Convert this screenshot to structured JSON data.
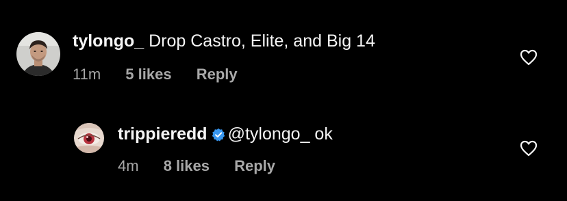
{
  "comments": [
    {
      "username": "tylongo_",
      "text": "Drop Castro, Elite, and Big 14",
      "time": "11m",
      "likes": "5 likes",
      "reply": "Reply",
      "verified": false
    },
    {
      "username": "trippieredd",
      "text": "@tylongo_ ok",
      "time": "4m",
      "likes": "8 likes",
      "reply": "Reply",
      "verified": true
    }
  ],
  "icons": {
    "like": "heart-outline-icon",
    "verified": "verified-badge-icon"
  },
  "colors": {
    "background": "#000000",
    "primary_text": "#f5f5f5",
    "secondary_text": "#a8a8a8",
    "verified_blue": "#3897f0"
  }
}
